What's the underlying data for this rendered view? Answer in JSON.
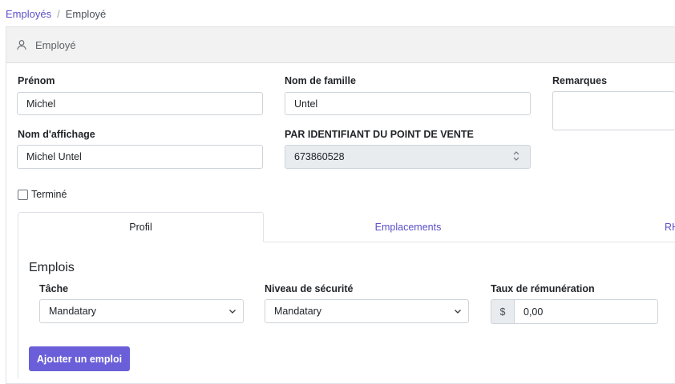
{
  "breadcrumb": {
    "parent": "Employés",
    "separator": "/",
    "current": "Employé"
  },
  "header": {
    "title": "Employé",
    "icon": "user-icon"
  },
  "form": {
    "first_name_label": "Prénom",
    "first_name_value": "Michel",
    "last_name_label": "Nom de famille",
    "last_name_value": "Untel",
    "remarks_label": "Remarques",
    "display_name_label": "Nom d'affichage",
    "display_name_value": "Michel Untel",
    "pos_id_label": "PAR IDENTIFIANT DU POINT DE VENTE",
    "pos_id_value": "673860528",
    "terminated_label": "Terminé",
    "terminated_checked": false
  },
  "tabs": [
    {
      "label": "Profil",
      "active": true
    },
    {
      "label": "Emplacements",
      "active": false
    },
    {
      "label": "RH",
      "active": false
    }
  ],
  "jobs": {
    "title": "Emplois",
    "task_label": "Tâche",
    "task_value": "Mandatary",
    "security_label": "Niveau de sécurité",
    "security_value": "Mandatary",
    "rate_label": "Taux de rémunération",
    "rate_prefix": "$",
    "rate_value": "0,00",
    "add_button": "Ajouter un emploi"
  },
  "colors": {
    "accent": "#5a51c9",
    "button": "#6a5fd8",
    "header_bg": "#f2f2f2"
  }
}
